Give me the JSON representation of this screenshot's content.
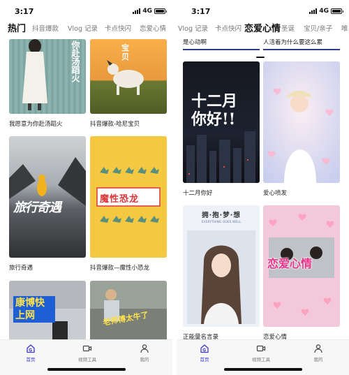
{
  "left_screen": {
    "status": {
      "time": "3:17",
      "network": "4G"
    },
    "tabs": [
      "热门",
      "抖音爆款",
      "Vlog 记录",
      "卡点快闪",
      "恋爱心情"
    ],
    "active_tab": "热门",
    "cards": [
      {
        "title": "我愿意为你赴汤蹈火",
        "overlay": "你赴汤蹈火"
      },
      {
        "title": "抖音爆款-哈尼宝贝",
        "overlay": "宝贝"
      },
      {
        "title": "旅行奇遇",
        "overlay": "旅行奇遇"
      },
      {
        "title": "抖音爆款—魔性小恐龙",
        "overlay": "魔性恐龙"
      },
      {
        "title": "",
        "overlay": "康博快上网"
      },
      {
        "title": "",
        "overlay": "老师傅太牛了"
      }
    ],
    "nav": [
      "首页",
      "视频工具",
      "我的"
    ]
  },
  "right_screen": {
    "status": {
      "time": "3:17",
      "network": "4G"
    },
    "tabs": [
      "Vlog 记录",
      "卡点快闪",
      "恋爱心情",
      "圣诞",
      "宝贝/亲子",
      "唯"
    ],
    "active_tab": "恋爱心情",
    "top_titles": [
      "是心动啊",
      "人活着为什么要这么累"
    ],
    "cards": [
      {
        "title": "十二月你好",
        "overlay": "十二月你好!!"
      },
      {
        "title": "爱心喷发",
        "overlay": ""
      },
      {
        "title": "正能量名言录",
        "overlay": "拥·抱·梦·想",
        "sub_overlay": "EVERYTHING GOES WELL"
      },
      {
        "title": "恋爱心情",
        "overlay": "恋爱心情"
      }
    ],
    "nav": [
      "首页",
      "视频工具",
      "我的"
    ]
  },
  "colors": {
    "accent": "#3a3acc",
    "yellow_card": "#f5c842",
    "dark_card": "#1d1f24"
  }
}
